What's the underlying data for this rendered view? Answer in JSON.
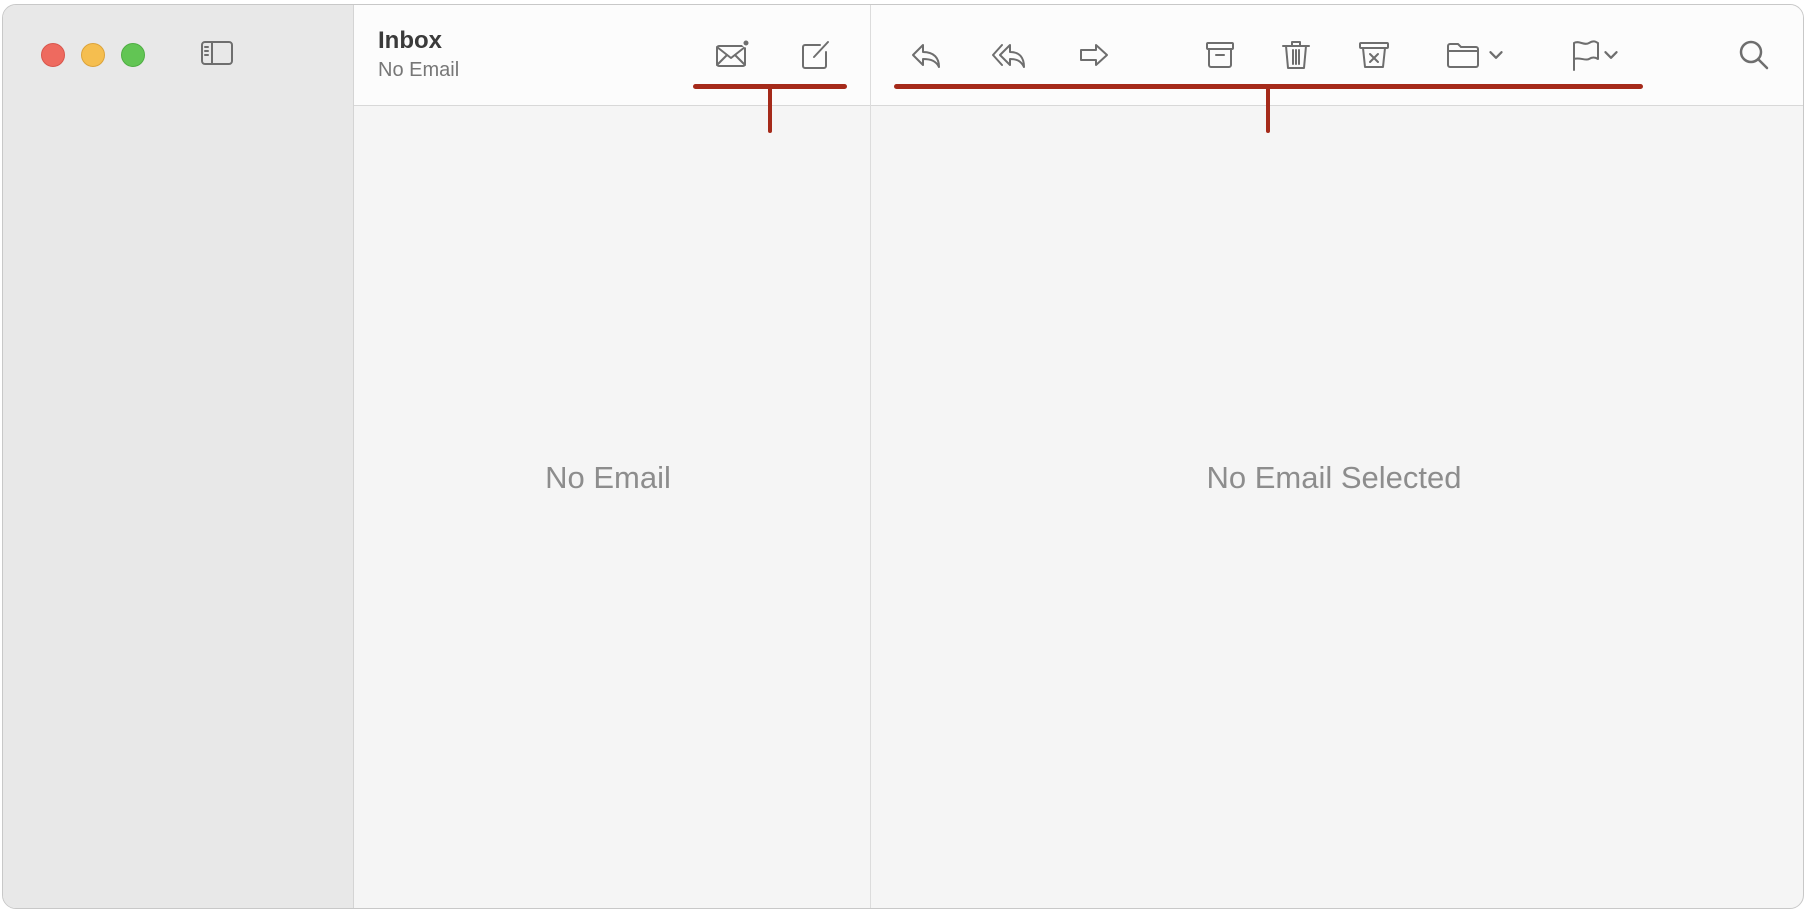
{
  "mailbox": {
    "title": "Inbox",
    "subtitle": "No Email"
  },
  "list": {
    "empty_text": "No Email"
  },
  "viewer": {
    "empty_text": "No Email Selected"
  },
  "colors": {
    "close": "#ee6a5f",
    "minimize": "#f5be4f",
    "zoom": "#62c554",
    "callout": "#a52a1a"
  }
}
